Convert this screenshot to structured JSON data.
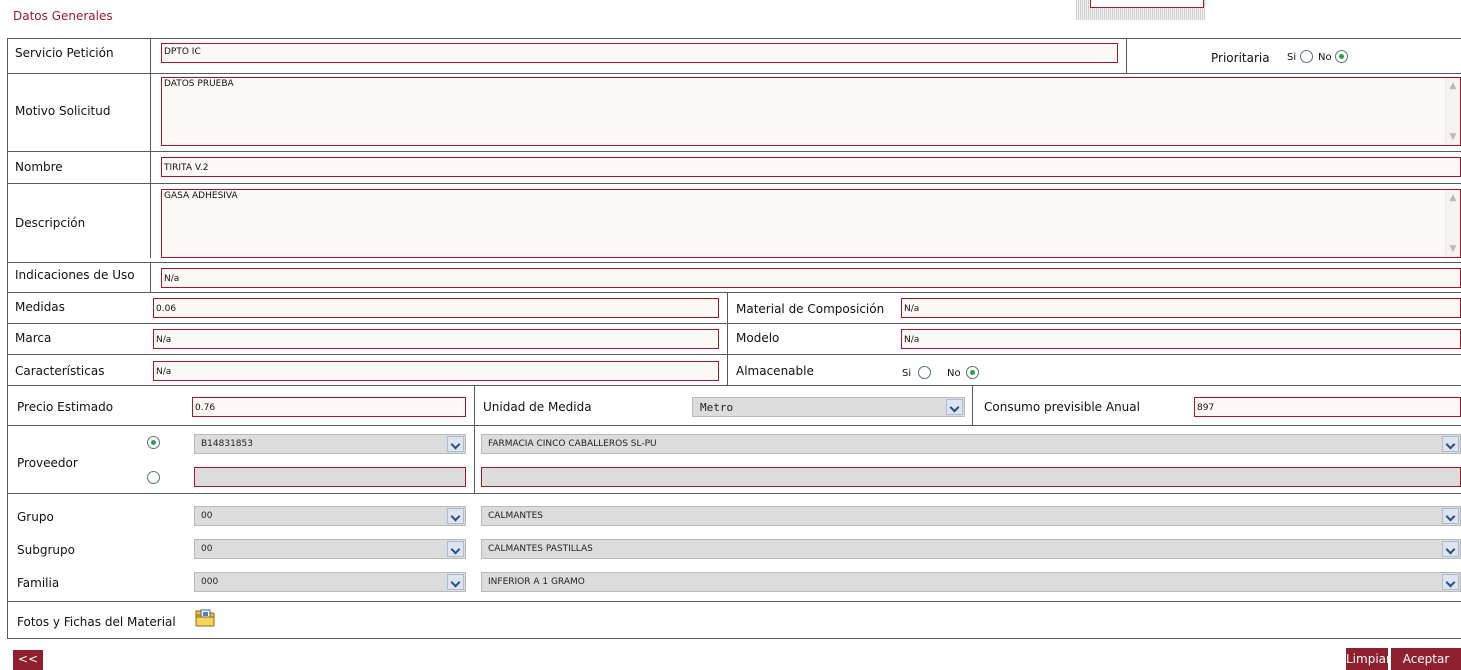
{
  "section_title": "Datos Generales",
  "general": {
    "servicio_label": "Servicio Petición",
    "servicio_value": "DPTO IC",
    "prioritaria_label": "Prioritaria",
    "si_label": "Si",
    "no_label": "No",
    "prioritaria_selected": "No",
    "motivo_label": "Motivo Solicitud",
    "motivo_value": "DATOS PRUEBA",
    "nombre_label": "Nombre",
    "nombre_value": "TIRITA V.2",
    "descripcion_label": "Descripción",
    "descripcion_value": "GASA ADHESIVA",
    "indicaciones_label": "Indicaciones de Uso",
    "indicaciones_value": "N/a"
  },
  "details": {
    "medidas_label": "Medidas",
    "medidas_value": "0.06",
    "material_label": "Material de Composición",
    "material_value": "N/a",
    "marca_label": "Marca",
    "marca_value": "N/a",
    "modelo_label": "Modelo",
    "modelo_value": "N/a",
    "caracteristicas_label": "Características",
    "caracteristicas_value": "N/a",
    "almacenable_label": "Almacenable",
    "almacenable_selected": "No"
  },
  "pricing": {
    "precio_label": "Precio Estimado",
    "precio_value": "0.76",
    "unidad_label": "Unidad de Medida",
    "unidad_value": "Metro",
    "consumo_label": "Consumo previsible Anual",
    "consumo_value": "897"
  },
  "proveedor": {
    "label": "Proveedor",
    "selected_option": 1,
    "cif_value": "B14831853",
    "name_value": "FARMACIA CINCO CABALLEROS SL-PU",
    "alt_cif_value": "",
    "alt_name_value": ""
  },
  "classification": {
    "grupo_label": "Grupo",
    "grupo_code": "00",
    "grupo_name": "CALMANTES",
    "subgrupo_label": "Subgrupo",
    "subgrupo_code": "00",
    "subgrupo_name": "CALMANTES PASTILLAS",
    "familia_label": "Familia",
    "familia_code": "000",
    "familia_name": "INFERIOR A 1 GRAMO"
  },
  "fotos_label": "Fotos y Fichas del Material",
  "buttons": {
    "back": "<<",
    "limpiar": "Limpiar",
    "aceptar": "Aceptar"
  },
  "icons": {
    "folder": "folder-icon",
    "dropdown": "chevron-down-icon"
  },
  "colors": {
    "accent": "#8e1f2c",
    "field_border": "#9a1c2a",
    "field_bg": "#fcf8f5",
    "radio_on": "#28a046",
    "select_bg": "#dcdcdc"
  }
}
